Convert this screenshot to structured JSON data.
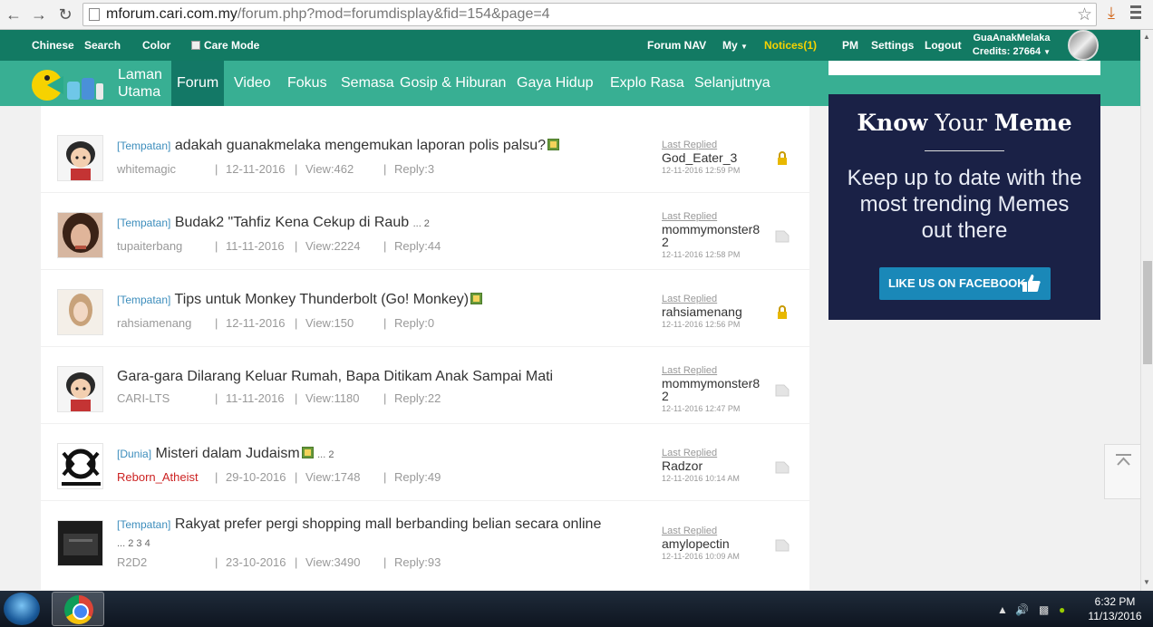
{
  "browser": {
    "url_host": "mforum.cari.com.my",
    "url_path": "/forum.php?mod=forumdisplay&fid=154&page=4"
  },
  "topbar": {
    "chinese": "Chinese",
    "search": "Search",
    "color": "Color",
    "care_mode": "Care Mode",
    "forum_nav": "Forum NAV",
    "my": "My",
    "notices": "Notices(1)",
    "pm": "PM",
    "settings": "Settings",
    "logout": "Logout",
    "username": "GuaAnakMelaka",
    "credits": "Credits: 27664"
  },
  "nav": {
    "home_line1": "Laman",
    "home_line2": "Utama",
    "items": [
      "Forum",
      "Video",
      "Fokus",
      "Semasa",
      "Gosip & Hiburan",
      "Gaya Hidup",
      "Explo Rasa",
      "Selanjutnya"
    ]
  },
  "threads": [
    {
      "tag": "[Tempatan]",
      "title": "adakah guanakmelaka mengemukan laporan polis palsu?",
      "pages": "",
      "author": "whitemagic",
      "date": "12-11-2016",
      "views": "View:462",
      "replies": "Reply:3",
      "last_label": "Last Replied",
      "last_user": "God_Eater_3",
      "last_time": "12-11-2016 12:59 PM",
      "status": "lock-icon"
    },
    {
      "tag": "[Tempatan]",
      "title": "Budak2 \"Tahfiz Kena Cekup di Raub",
      "pages": "... 2",
      "author": "tupaiterbang",
      "date": "11-11-2016",
      "views": "View:2224",
      "replies": "Reply:44",
      "last_label": "Last Replied",
      "last_user": "mommymonster82",
      "last_time": "12-11-2016 12:58 PM",
      "status": "folder-icon"
    },
    {
      "tag": "[Tempatan]",
      "title": "Tips untuk Monkey Thunderbolt (Go! Monkey)",
      "pages": "",
      "author": "rahsiamenang",
      "date": "12-11-2016",
      "views": "View:150",
      "replies": "Reply:0",
      "last_label": "Last Replied",
      "last_user": "rahsiamenang",
      "last_time": "12-11-2016 12:56 PM",
      "status": "lock-icon"
    },
    {
      "tag": "",
      "title": "Gara-gara Dilarang Keluar Rumah, Bapa Ditikam Anak Sampai Mati",
      "pages": "",
      "author": "CARI-LTS",
      "date": "11-11-2016",
      "views": "View:1180",
      "replies": "Reply:22",
      "last_label": "Last Replied",
      "last_user": "mommymonster82",
      "last_time": "12-11-2016 12:47 PM",
      "status": "folder-icon"
    },
    {
      "tag": "[Dunia]",
      "title": "Misteri dalam Judaism",
      "pages": "... 2",
      "author": "Reborn_Atheist",
      "date": "29-10-2016",
      "views": "View:1748",
      "replies": "Reply:49",
      "last_label": "Last Replied",
      "last_user": "Radzor",
      "last_time": "12-11-2016 10:14 AM",
      "status": "folder-icon"
    },
    {
      "tag": "[Tempatan]",
      "title": "Rakyat prefer pergi shopping mall berbanding belian secara online",
      "pages": "... 2  3  4",
      "author": "R2D2",
      "date": "23-10-2016",
      "views": "View:3490",
      "replies": "Reply:93",
      "last_label": "Last Replied",
      "last_user": "amylopectin",
      "last_time": "12-11-2016 10:09 AM",
      "status": "folder-icon"
    }
  ],
  "ad": {
    "brand_bold1": "Know",
    "brand_light": " Your ",
    "brand_bold2": "Meme",
    "tagline": "Keep up to date with the most trending Memes out there",
    "button": "LIKE US ON FACEBOOK"
  },
  "taskbar": {
    "time": "6:32 PM",
    "date": "11/13/2016"
  },
  "colors": {
    "topbar": "#127a63",
    "nav": "#2aaa8c",
    "notices": "#f6d200",
    "ad_bg": "#1a2146",
    "ad_button": "#1a88b8"
  }
}
